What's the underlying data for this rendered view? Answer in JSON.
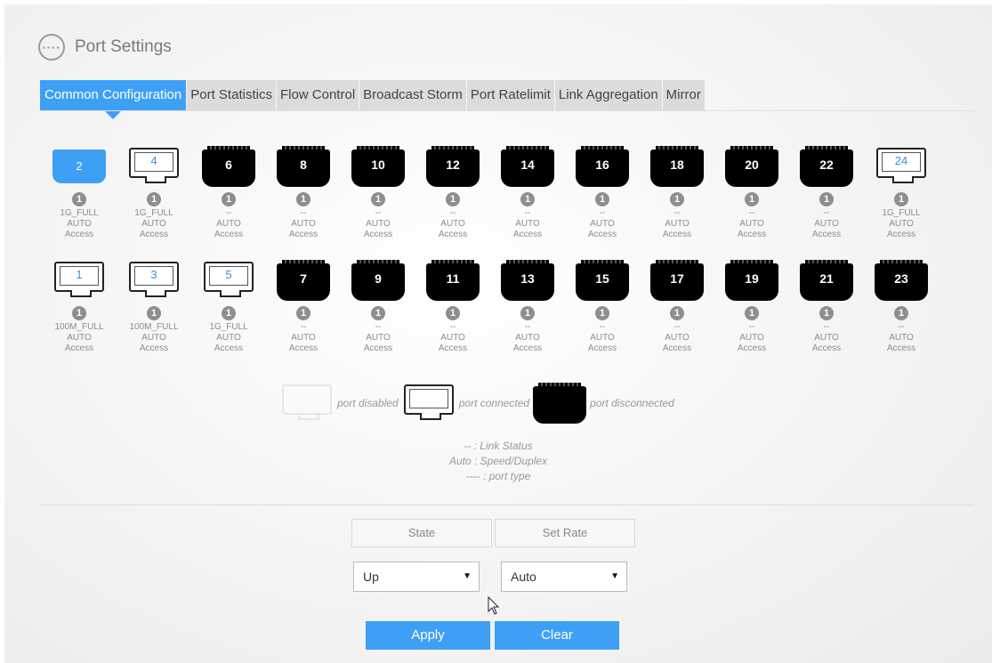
{
  "header": {
    "title": "Port Settings",
    "icon": "more-dots-icon",
    "icon_glyph": "····"
  },
  "tabs": [
    {
      "label": "Common Configuration",
      "active": true
    },
    {
      "label": "Port Statistics",
      "active": false
    },
    {
      "label": "Flow Control",
      "active": false
    },
    {
      "label": "Broadcast Storm",
      "active": false
    },
    {
      "label": "Port Ratelimit",
      "active": false
    },
    {
      "label": "Link Aggregation",
      "active": false
    },
    {
      "label": "Mirror",
      "active": false
    }
  ],
  "ports_top": [
    {
      "num": "2",
      "state": "selected",
      "info": "1",
      "link": "1G_FULL",
      "speed": "AUTO",
      "type": "Access"
    },
    {
      "num": "4",
      "state": "connected",
      "info": "1",
      "link": "1G_FULL",
      "speed": "AUTO",
      "type": "Access"
    },
    {
      "num": "6",
      "state": "disconnected",
      "info": "1",
      "link": "--",
      "speed": "AUTO",
      "type": "Access"
    },
    {
      "num": "8",
      "state": "disconnected",
      "info": "1",
      "link": "--",
      "speed": "AUTO",
      "type": "Access"
    },
    {
      "num": "10",
      "state": "disconnected",
      "info": "1",
      "link": "--",
      "speed": "AUTO",
      "type": "Access"
    },
    {
      "num": "12",
      "state": "disconnected",
      "info": "1",
      "link": "--",
      "speed": "AUTO",
      "type": "Access"
    },
    {
      "num": "14",
      "state": "disconnected",
      "info": "1",
      "link": "--",
      "speed": "AUTO",
      "type": "Access"
    },
    {
      "num": "16",
      "state": "disconnected",
      "info": "1",
      "link": "--",
      "speed": "AUTO",
      "type": "Access"
    },
    {
      "num": "18",
      "state": "disconnected",
      "info": "1",
      "link": "--",
      "speed": "AUTO",
      "type": "Access"
    },
    {
      "num": "20",
      "state": "disconnected",
      "info": "1",
      "link": "--",
      "speed": "AUTO",
      "type": "Access"
    },
    {
      "num": "22",
      "state": "disconnected",
      "info": "1",
      "link": "--",
      "speed": "AUTO",
      "type": "Access"
    },
    {
      "num": "24",
      "state": "connected",
      "info": "1",
      "link": "1G_FULL",
      "speed": "AUTO",
      "type": "Access"
    }
  ],
  "ports_bottom": [
    {
      "num": "1",
      "state": "connected",
      "info": "1",
      "link": "100M_FULL",
      "speed": "AUTO",
      "type": "Access"
    },
    {
      "num": "3",
      "state": "connected",
      "info": "1",
      "link": "100M_FULL",
      "speed": "AUTO",
      "type": "Access"
    },
    {
      "num": "5",
      "state": "connected",
      "info": "1",
      "link": "1G_FULL",
      "speed": "AUTO",
      "type": "Access"
    },
    {
      "num": "7",
      "state": "disconnected",
      "info": "1",
      "link": "--",
      "speed": "AUTO",
      "type": "Access"
    },
    {
      "num": "9",
      "state": "disconnected",
      "info": "1",
      "link": "--",
      "speed": "AUTO",
      "type": "Access"
    },
    {
      "num": "11",
      "state": "disconnected",
      "info": "1",
      "link": "--",
      "speed": "AUTO",
      "type": "Access"
    },
    {
      "num": "13",
      "state": "disconnected",
      "info": "1",
      "link": "--",
      "speed": "AUTO",
      "type": "Access"
    },
    {
      "num": "15",
      "state": "disconnected",
      "info": "1",
      "link": "--",
      "speed": "AUTO",
      "type": "Access"
    },
    {
      "num": "17",
      "state": "disconnected",
      "info": "1",
      "link": "--",
      "speed": "AUTO",
      "type": "Access"
    },
    {
      "num": "19",
      "state": "disconnected",
      "info": "1",
      "link": "--",
      "speed": "AUTO",
      "type": "Access"
    },
    {
      "num": "21",
      "state": "disconnected",
      "info": "1",
      "link": "--",
      "speed": "AUTO",
      "type": "Access"
    },
    {
      "num": "23",
      "state": "disconnected",
      "info": "1",
      "link": "--",
      "speed": "AUTO",
      "type": "Access"
    }
  ],
  "legend": {
    "disabled": "port disabled",
    "connected": "port connected",
    "disconnected": "port disconnected"
  },
  "notes": [
    "-- : Link Status",
    "Auto : Speed/Duplex",
    "---- : port type"
  ],
  "form": {
    "state_header": "State",
    "rate_header": "Set Rate",
    "state_value": "Up",
    "rate_value": "Auto",
    "caret": "▼"
  },
  "buttons": {
    "apply": "Apply",
    "clear": "Clear"
  },
  "colors": {
    "accent": "#3ea0f5",
    "jack": "#000000",
    "text_muted": "#8c8c8c"
  }
}
